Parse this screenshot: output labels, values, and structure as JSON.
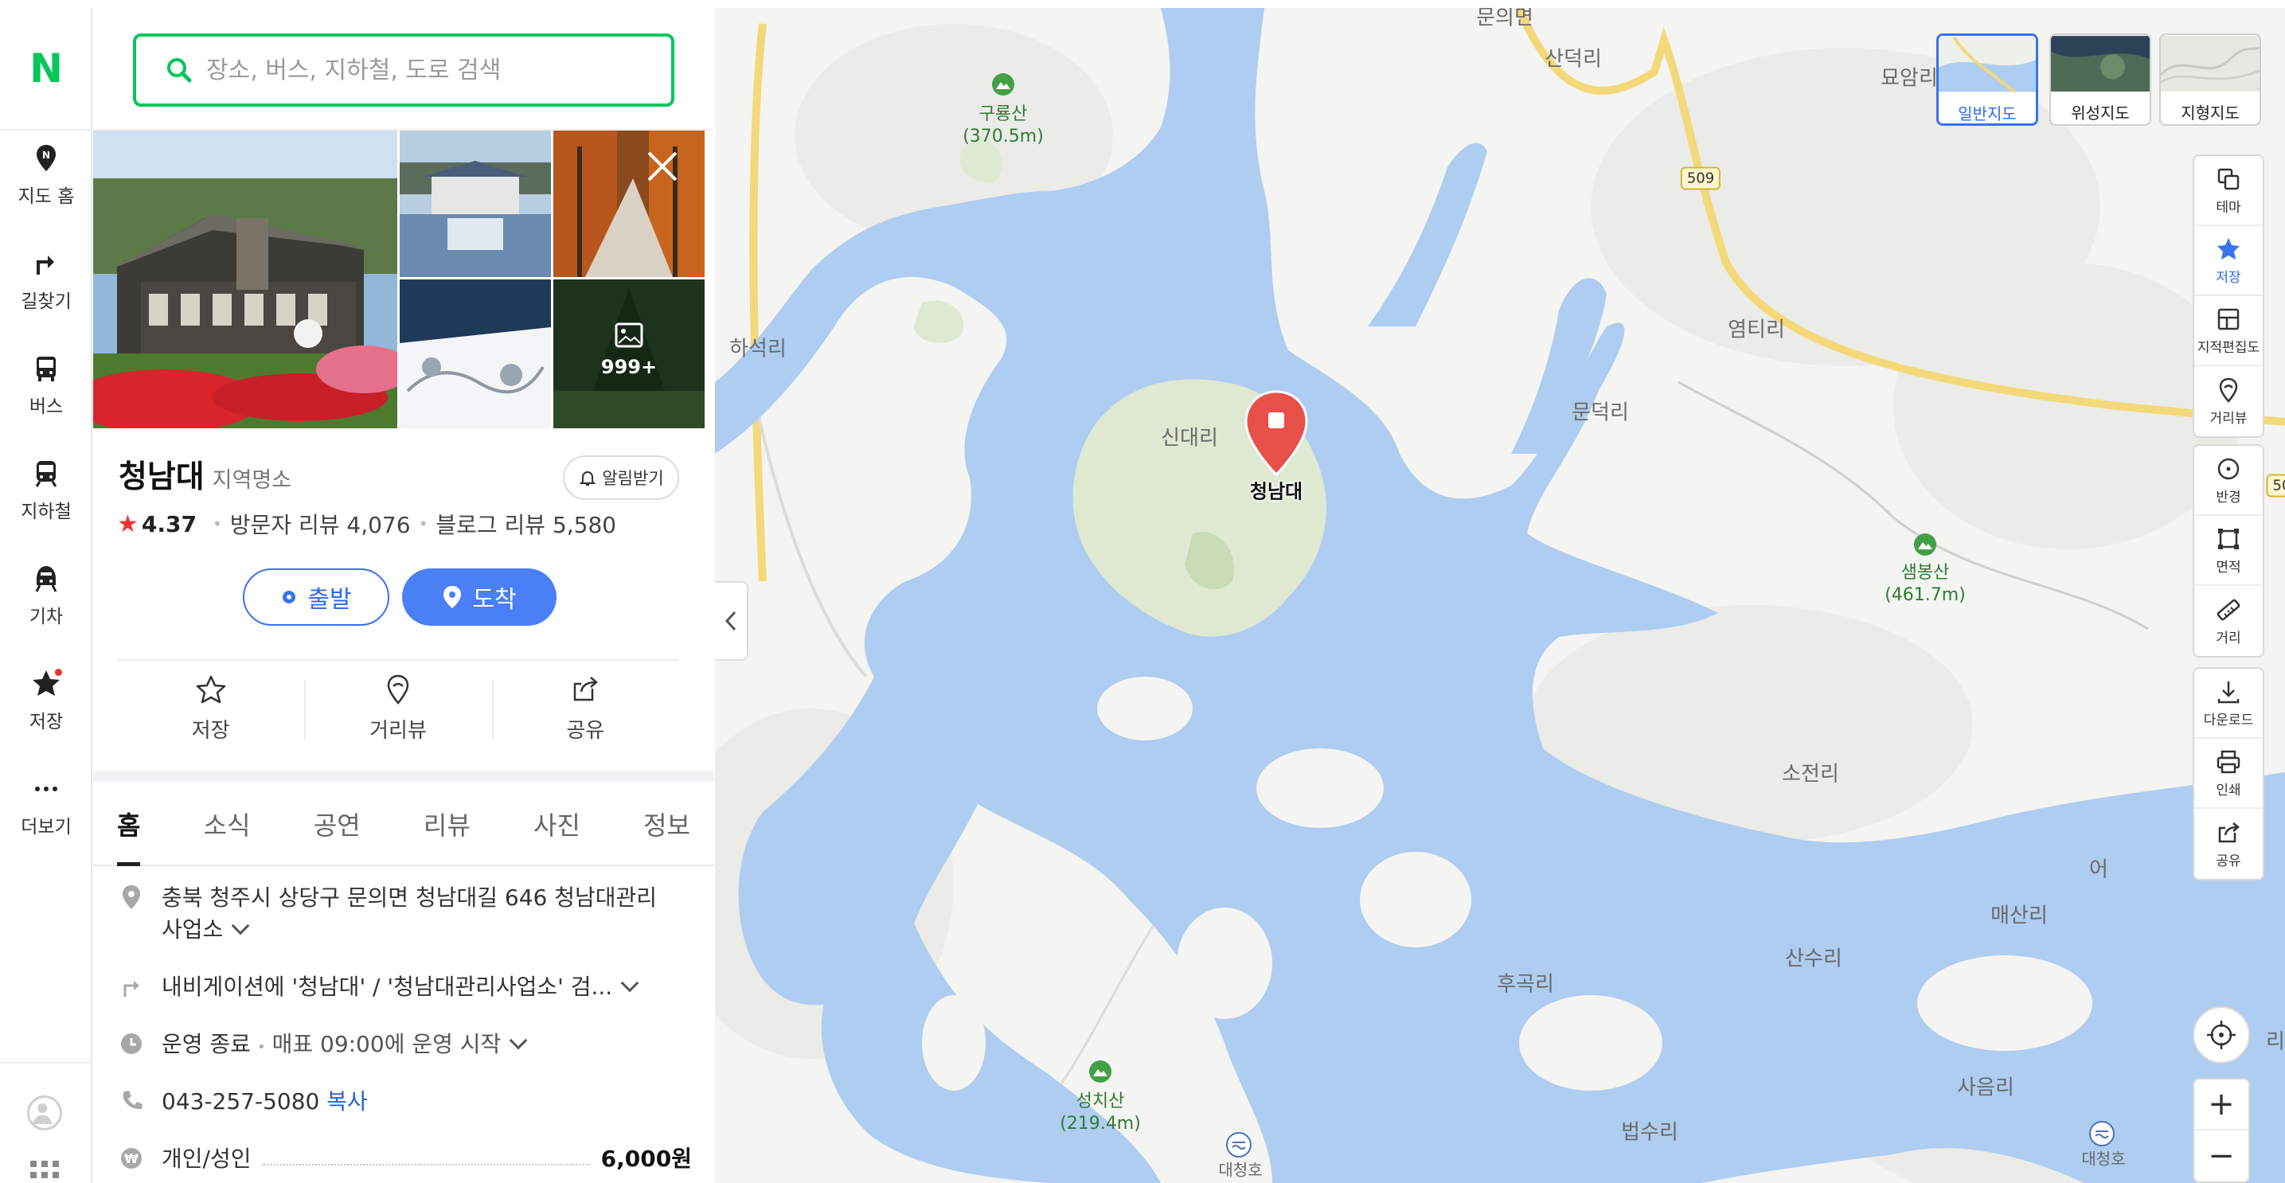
{
  "brand": {
    "logo_letter": "N",
    "accent": "#03c75a"
  },
  "rail": {
    "items": [
      {
        "label": "지도 홈",
        "icon": "map-home-icon"
      },
      {
        "label": "길찾기",
        "icon": "directions-icon"
      },
      {
        "label": "버스",
        "icon": "bus-icon"
      },
      {
        "label": "지하철",
        "icon": "subway-icon"
      },
      {
        "label": "기차",
        "icon": "train-icon"
      },
      {
        "label": "저장",
        "icon": "star-icon",
        "has_dot": true
      },
      {
        "label": "더보기",
        "icon": "more-icon"
      }
    ]
  },
  "search": {
    "placeholder": "장소, 버스, 지하철, 도로 검색",
    "value": ""
  },
  "photos": {
    "more_count": "999+"
  },
  "place": {
    "name": "청남대",
    "category": "지역명소",
    "alarm_label": "알림받기",
    "rating": "4.37",
    "visitor_reviews": "방문자 리뷰 4,076",
    "blog_reviews": "블로그 리뷰 5,580",
    "depart_label": "출발",
    "arrive_label": "도착",
    "actions": [
      {
        "label": "저장",
        "icon": "star-outline-icon"
      },
      {
        "label": "거리뷰",
        "icon": "street-view-icon"
      },
      {
        "label": "공유",
        "icon": "share-icon"
      }
    ]
  },
  "tabs": [
    {
      "label": "홈",
      "active": true
    },
    {
      "label": "소식"
    },
    {
      "label": "공연"
    },
    {
      "label": "리뷰"
    },
    {
      "label": "사진"
    },
    {
      "label": "정보"
    }
  ],
  "info": {
    "address_line1": "충북 청주시 상당구 문의면 청남대길 646 청남대관리",
    "address_line2": "사업소",
    "navigation": "내비게이션에 '청남대' / '청남대관리사업소' 검...",
    "hours_status": "운영 종료",
    "hours_detail": "매표 09:00에 운영 시작",
    "phone": "043-257-5080",
    "copy_label": "복사",
    "price_label": "개인/성인",
    "price_value": "6,000원"
  },
  "map": {
    "pin_label": "청남대",
    "map_types": [
      {
        "label": "일반지도",
        "active": true
      },
      {
        "label": "위성지도"
      },
      {
        "label": "지형지도"
      }
    ],
    "controls_group1": [
      {
        "label": "테마",
        "icon": "theme-icon"
      },
      {
        "label": "저장",
        "icon": "star-icon",
        "active": true
      },
      {
        "label": "지적편집도",
        "icon": "cadastral-icon"
      },
      {
        "label": "거리뷰",
        "icon": "street-view-icon"
      }
    ],
    "controls_group2": [
      {
        "label": "반경",
        "icon": "radius-icon"
      },
      {
        "label": "면적",
        "icon": "area-icon"
      },
      {
        "label": "거리",
        "icon": "ruler-icon"
      }
    ],
    "controls_group3": [
      {
        "label": "다운로드",
        "icon": "download-icon"
      },
      {
        "label": "인쇄",
        "icon": "print-icon"
      },
      {
        "label": "공유",
        "icon": "share-icon"
      }
    ],
    "zoom_in": "+",
    "zoom_out": "−",
    "labels": {
      "munui": "문의면",
      "sandeok": "산덕리",
      "myoam": "묘암리",
      "road509": "509",
      "guryong_name": "구룡산",
      "guryong_height": "(370.5m)",
      "haseok": "하석리",
      "yeomti": "염티리",
      "sindae": "신대리",
      "mundeok": "문덕리",
      "saembong_name": "샘봉산",
      "saembong_height": "(461.7m)",
      "sojeon": "소전리",
      "maesan": "매산리",
      "sansu": "산수리",
      "hugok": "후곡리",
      "seongchi_name": "성치산",
      "seongchi_height": "(219.4m)",
      "beopsu": "법수리",
      "saeum": "사음리",
      "daecheong1": "대청호",
      "daecheong2": "대청호",
      "eo": "어",
      "ri_edge": "리",
      "road_edge": "50"
    }
  }
}
